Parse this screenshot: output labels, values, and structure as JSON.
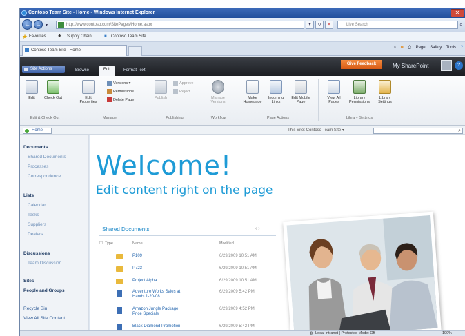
{
  "window": {
    "title": "Contoso Team Site - Home - Windows Internet Explorer"
  },
  "nav": {
    "url": "http://www.contoso.com/SitePages/Home.aspx",
    "search_placeholder": "Live Search"
  },
  "favorites": {
    "label": "Favorites",
    "items": [
      "Supply Chain",
      "Contoso Team Site"
    ]
  },
  "tabs": [
    {
      "label": "Contoso Team Site - Home"
    }
  ],
  "commandbar": {
    "items": [
      "Page",
      "Safety",
      "Tools"
    ]
  },
  "sharepoint": {
    "site_actions": "Site Actions",
    "tabs": [
      "Browse",
      "Edit",
      "Format Text"
    ],
    "give_feedback": "Give Feedback",
    "my_sharepoint": "My SharePoint",
    "help": "?"
  },
  "ribbon": {
    "buttons": [
      {
        "label": "Edit"
      },
      {
        "label": "Check Out"
      },
      {
        "label": "Edit Properties"
      },
      {
        "label": "Versions"
      },
      {
        "label": "Permissions"
      },
      {
        "label": "Delete Page"
      },
      {
        "label": "Publish"
      },
      {
        "label": "Approve"
      },
      {
        "label": "Reject"
      },
      {
        "label": "Manage Versions"
      },
      {
        "label": "Make Homepage"
      },
      {
        "label": "Incoming Links"
      },
      {
        "label": "Edit Mobile Page"
      },
      {
        "label": "View All Pages"
      },
      {
        "label": "Library Permissions"
      },
      {
        "label": "Library Settings"
      }
    ],
    "groups": [
      "Edit & Check Out",
      "Manage",
      "Publishing",
      "Workflow",
      "Page Actions",
      "Library Settings"
    ]
  },
  "breadcrumb": {
    "home": "Home",
    "scope": "This Site: Contoso Team Site"
  },
  "quicklaunch": {
    "documents": {
      "heading": "Documents",
      "items": [
        "Shared Documents",
        "Processes",
        "Correspondence"
      ]
    },
    "lists": {
      "heading": "Lists",
      "items": [
        "Calendar",
        "Tasks",
        "Suppliers",
        "Dealers"
      ]
    },
    "discussions": {
      "heading": "Discussions",
      "items": [
        "Team Discussion"
      ]
    },
    "sites": {
      "heading": "Sites"
    },
    "people": "People and Groups",
    "recycle": "Recycle Bin",
    "view_all": "View All Site Content"
  },
  "main": {
    "welcome": "Welcome!",
    "subhead": "Edit content right on the page",
    "shared_docs": {
      "title": "Shared Documents",
      "more": "‹ ›",
      "columns": [
        "Type",
        "Name",
        "Modified"
      ],
      "rows": [
        {
          "type": "folder",
          "name": "P109",
          "modified": "6/29/2009 10:51 AM"
        },
        {
          "type": "folder",
          "name": "P723",
          "modified": "6/29/2009 10:51 AM"
        },
        {
          "type": "folder",
          "name": "Project Alpha",
          "modified": "6/29/2009 10:51 AM"
        },
        {
          "type": "doc",
          "name": "Adventure Works Sales at Hands 1-20-08",
          "modified": "6/29/2009 5:42 PM"
        },
        {
          "type": "doc",
          "name": "Amazon Jungle Package Price Specials",
          "modified": "6/29/2009 4:52 PM"
        },
        {
          "type": "doc",
          "name": "Black Diamond Promotion",
          "modified": "6/29/2009 5:42 PM"
        }
      ]
    }
  },
  "status": {
    "zone": "Local intranet | Protected Mode: Off",
    "zoom": "100%"
  }
}
